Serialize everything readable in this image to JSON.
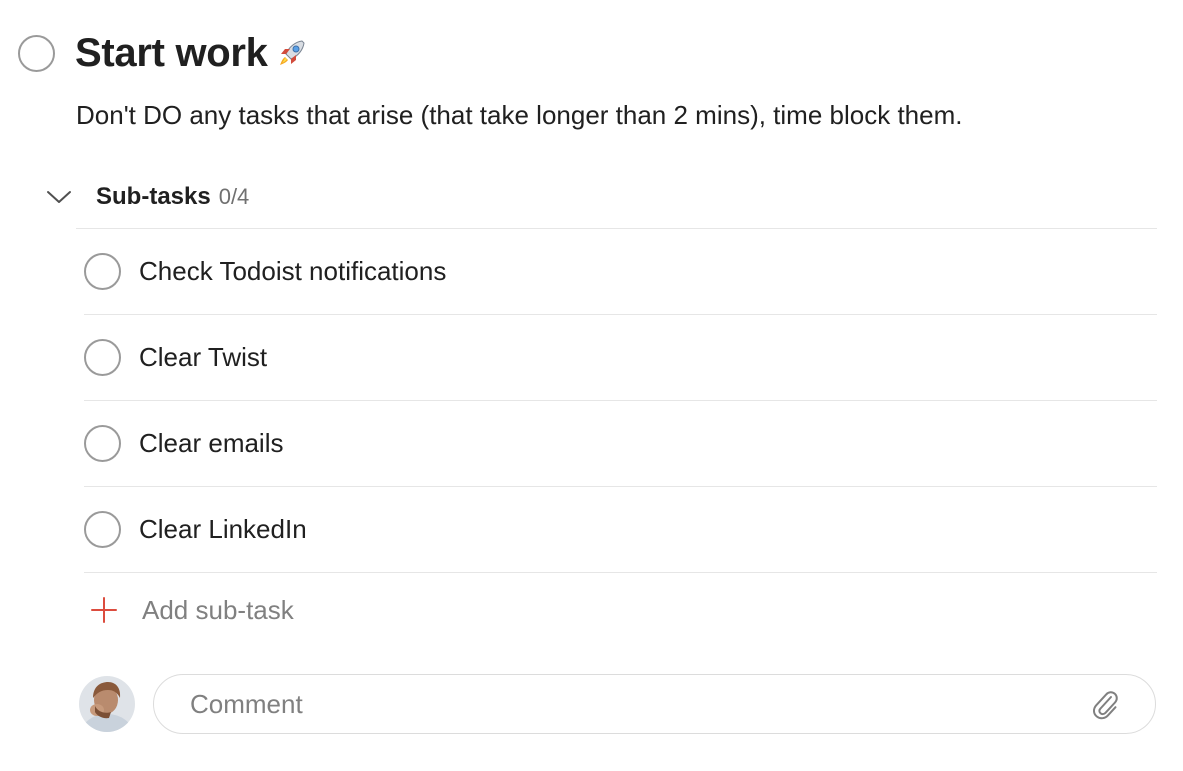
{
  "task": {
    "title": "Start work",
    "title_emoji_icon": "rocket-icon",
    "description": "Don't DO any tasks that arise (that take longer than 2 mins), time block them."
  },
  "subtasks": {
    "title": "Sub-tasks",
    "count": "0/4",
    "items": [
      {
        "label": "Check Todoist notifications"
      },
      {
        "label": "Clear Twist"
      },
      {
        "label": "Clear emails"
      },
      {
        "label": "Clear LinkedIn"
      }
    ],
    "add_label": "Add sub-task"
  },
  "comment": {
    "placeholder": "Comment",
    "value": ""
  },
  "icons": {
    "collapse": "chevron-down-icon",
    "add": "plus-icon",
    "attach": "paperclip-icon",
    "avatar": "user-avatar"
  },
  "colors": {
    "text": "#202020",
    "muted": "#808080",
    "accent_add": "#dc4c3e",
    "circle_border": "#9a9a9a",
    "divider": "#e6e6e6"
  }
}
